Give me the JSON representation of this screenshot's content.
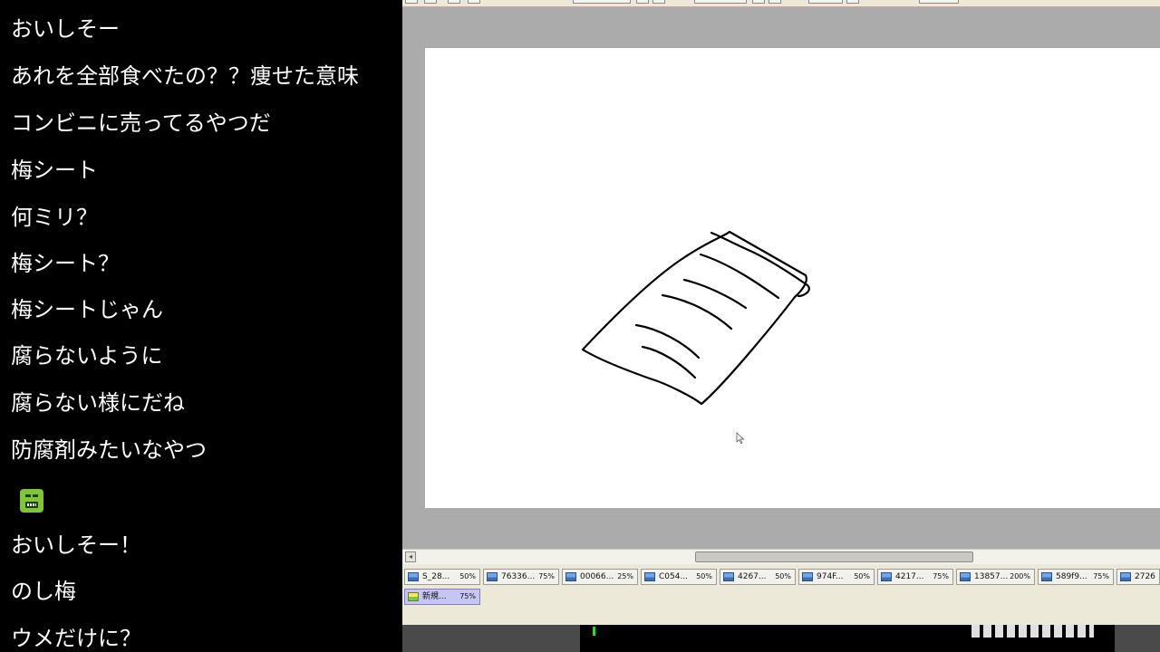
{
  "chat": {
    "messages": [
      "おいしそー",
      "あれを全部食べたの？？痩せた意味",
      "コンビニに売ってるやつだ",
      "梅シート",
      "何ミリ？",
      "梅シート？",
      "梅シートじゃん",
      "腐らないように",
      "腐らない様にだね",
      "防腐剤みたいなやつ",
      "おいしそー！",
      "のし梅",
      "ウメだけに？"
    ],
    "stamp_icon": "green-face-stamp-icon"
  },
  "app": {
    "canvas_bg": "#ffffff",
    "workspace_bg": "#ababab",
    "scroll_left_glyph": "◂",
    "tabs": [
      {
        "name": "S_28...",
        "zoom": "50%"
      },
      {
        "name": "76336...",
        "zoom": "75%"
      },
      {
        "name": "00066...",
        "zoom": "25%"
      },
      {
        "name": "C054...",
        "zoom": "50%"
      },
      {
        "name": "4267...",
        "zoom": "50%"
      },
      {
        "name": "974F...",
        "zoom": "50%"
      },
      {
        "name": "4217...",
        "zoom": "75%"
      },
      {
        "name": "13857...",
        "zoom": "200%"
      },
      {
        "name": "589f9...",
        "zoom": "75%"
      },
      {
        "name": "2726",
        "zoom": ""
      },
      {
        "name": "新規...",
        "zoom": "75%",
        "active": true
      }
    ]
  }
}
